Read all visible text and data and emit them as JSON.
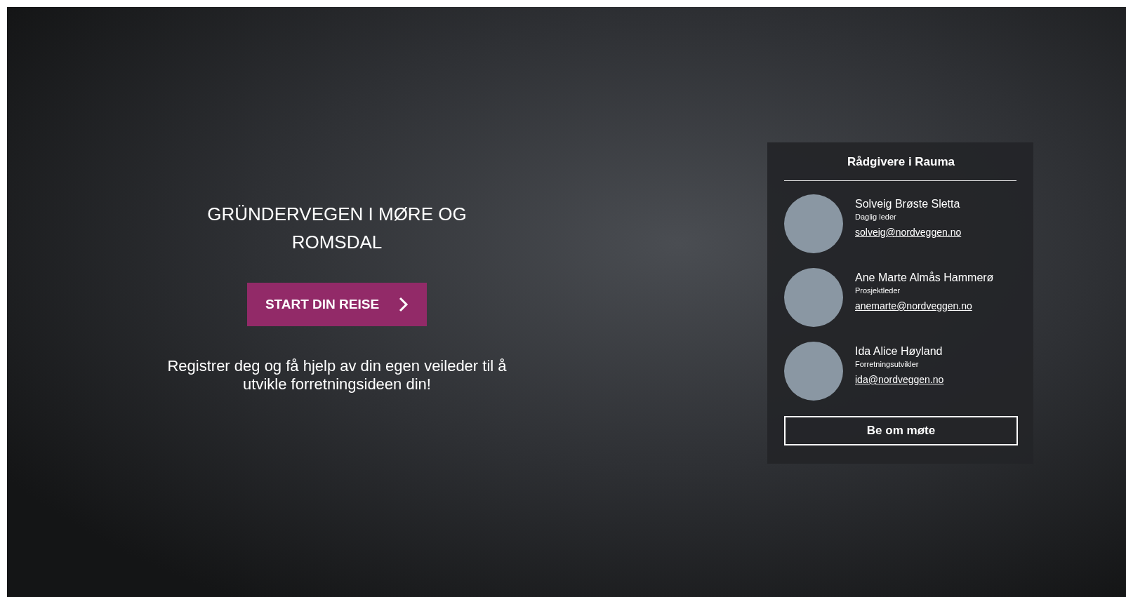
{
  "hero": {
    "title": "GRÜNDERVEGEN I MØRE OG ROMSDAL",
    "cta": "START DIN REISE",
    "text": "Registrer deg og få hjelp av din egen veileder til å utvikle forretningsideen din!"
  },
  "advisors_panel": {
    "title": "Rådgivere i Rauma",
    "advisors": [
      {
        "name": "Solveig Brøste Sletta",
        "role": "Daglig leder",
        "email": "solveig@nordveggen.no"
      },
      {
        "name": "Ane Marte Almås Hammerø",
        "role": "Prosjektleder",
        "email": "anemarte@nordveggen.no"
      },
      {
        "name": "Ida Alice Høyland",
        "role": "Forretningsutvikler",
        "email": "ida@nordveggen.no"
      }
    ],
    "button": "Be om møte"
  }
}
